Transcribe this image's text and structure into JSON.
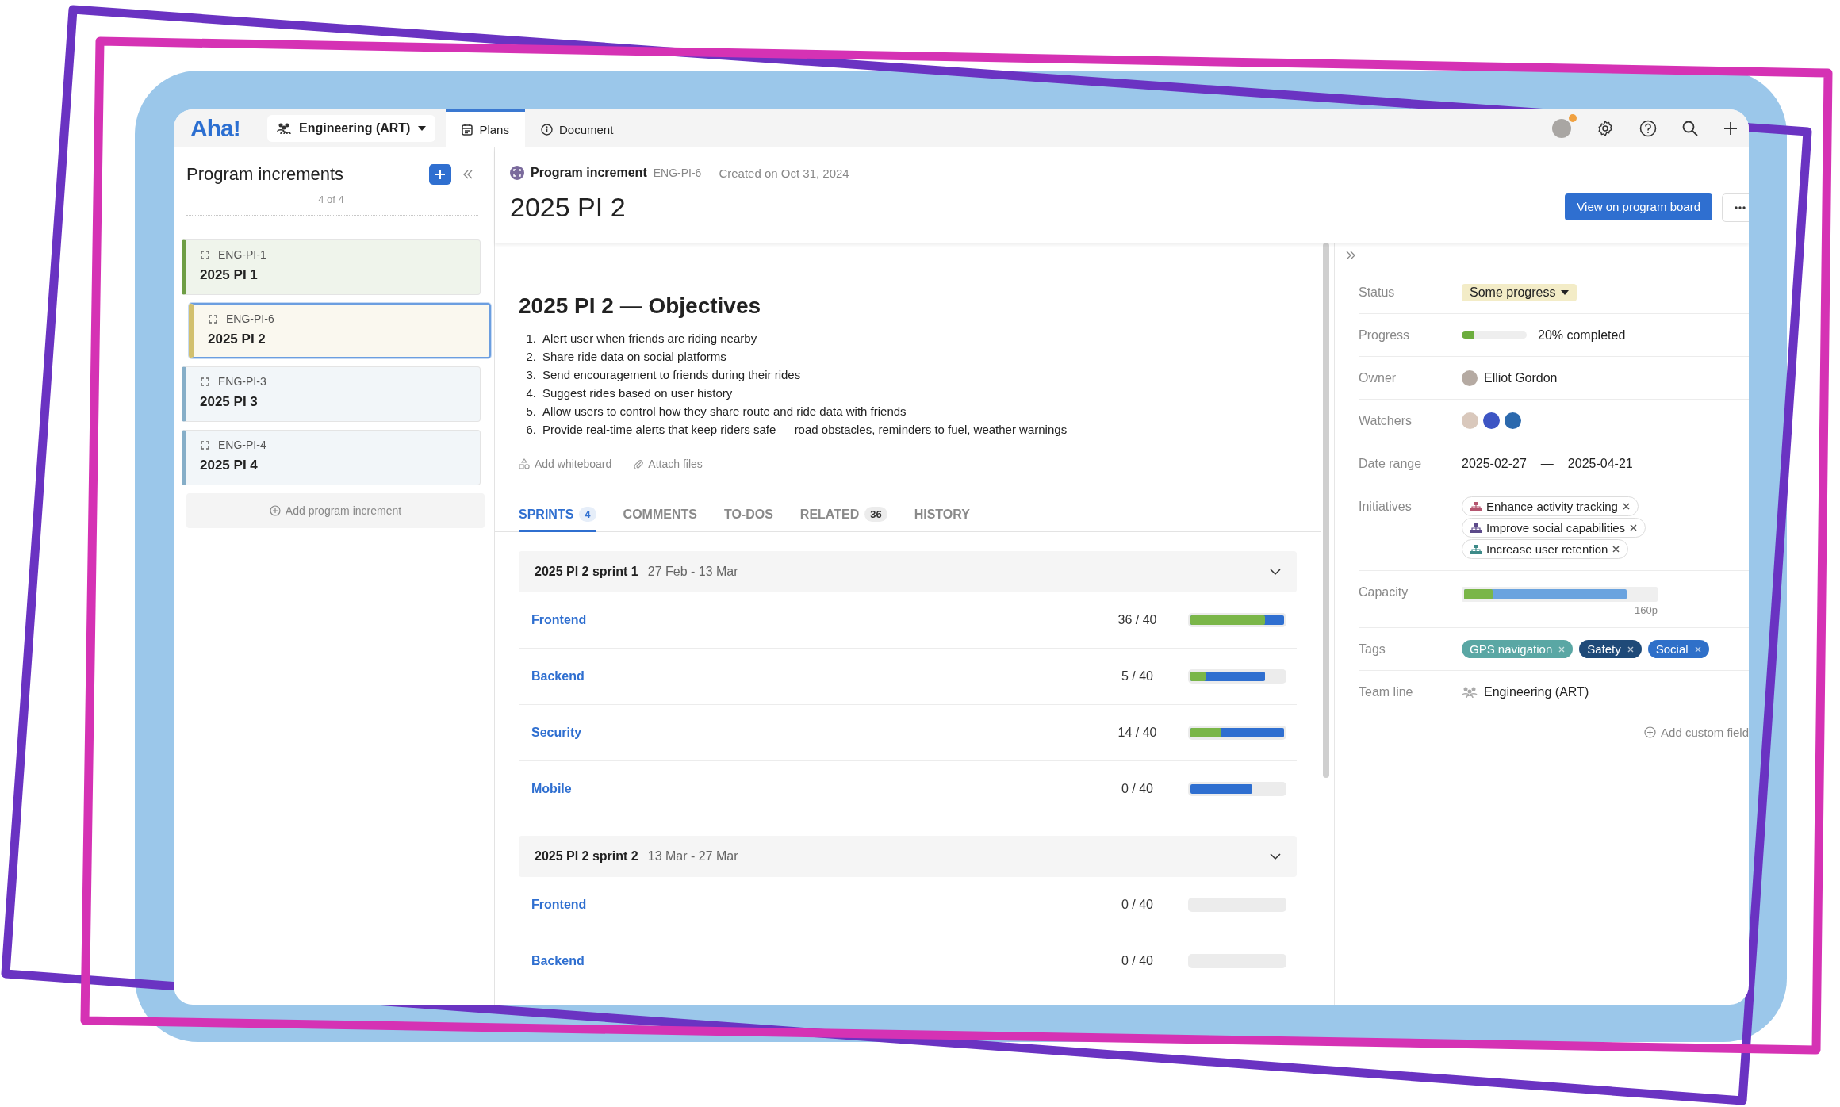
{
  "topbar": {
    "logo": "Aha!",
    "workspace": "Engineering (ART)",
    "tabs": [
      {
        "label": "Plans",
        "selected": true
      },
      {
        "label": "Document",
        "selected": false
      }
    ],
    "notification": true
  },
  "sidebar": {
    "title": "Program increments",
    "count": "4 of 4",
    "items": [
      {
        "ref": "ENG-PI-1",
        "name": "2025 PI 1",
        "color": "#6f9e45",
        "selected": false
      },
      {
        "ref": "ENG-PI-6",
        "name": "2025 PI 2",
        "color": "#d2c06e",
        "selected": true
      },
      {
        "ref": "ENG-PI-3",
        "name": "2025 PI 3",
        "color": "#86aec8",
        "selected": false
      },
      {
        "ref": "ENG-PI-4",
        "name": "2025 PI 4",
        "color": "#86aec8",
        "selected": false
      }
    ],
    "add_label": "Add program increment"
  },
  "record": {
    "type_label": "Program increment",
    "ref": "ENG-PI-6",
    "created": "Created on Oct 31, 2024",
    "title": "2025 PI 2",
    "primary_action": "View on program board"
  },
  "objectives": {
    "heading": "2025 PI 2 — Objectives",
    "items": [
      {
        "number": "1.",
        "text": "Alert user when friends are riding nearby"
      },
      {
        "number": "2.",
        "text": "Share ride data on social platforms"
      },
      {
        "number": "3.",
        "text": "Send encouragement to friends during their rides"
      },
      {
        "number": "4.",
        "text": "Suggest rides based on user history"
      },
      {
        "number": "5.",
        "text": "Allow users to control how they share route and ride data with friends"
      },
      {
        "number": "6.",
        "text": "Provide real-time alerts that keep riders safe — road obstacles, reminders to fuel, weather warnings"
      }
    ],
    "actions": [
      {
        "kind": "whiteboard",
        "label": "Add whiteboard"
      },
      {
        "kind": "attach",
        "label": "Attach files"
      }
    ]
  },
  "detail_tabs": [
    {
      "label": "SPRINTS",
      "count": "4",
      "selected": true
    },
    {
      "label": "COMMENTS",
      "selected": false
    },
    {
      "label": "TO-DOS",
      "selected": false
    },
    {
      "label": "RELATED",
      "count": "36",
      "selected": false
    },
    {
      "label": "HISTORY",
      "selected": false
    }
  ],
  "sprints": [
    {
      "name": "2025 PI 2 sprint 1",
      "dates": "27 Feb - 13 Mar",
      "expanded": true,
      "teams": [
        {
          "name": "Frontend",
          "reading": "36 / 40",
          "segments": [
            {
              "kind": "planned",
              "level": 1
            },
            {
              "kind": "done",
              "level": 0.8
            }
          ]
        },
        {
          "name": "Backend",
          "reading": "5 / 40",
          "segments": [
            {
              "kind": "planned",
              "level": 0.8
            },
            {
              "kind": "done",
              "level": 0.16
            }
          ]
        },
        {
          "name": "Security",
          "reading": "14 / 40",
          "segments": [
            {
              "kind": "planned",
              "level": 1
            },
            {
              "kind": "done",
              "level": 0.33
            }
          ]
        },
        {
          "name": "Mobile",
          "reading": "0 / 40",
          "segments": [
            {
              "kind": "planned",
              "level": 0.66
            }
          ]
        }
      ]
    },
    {
      "name": "2025 PI 2 sprint 2",
      "dates": "13 Mar - 27 Mar",
      "expanded": true,
      "teams": [
        {
          "name": "Frontend",
          "reading": "0 / 40"
        },
        {
          "name": "Backend",
          "reading": "0 / 40"
        }
      ]
    }
  ],
  "details": {
    "fields": [
      {
        "kind": "status",
        "label": "Status",
        "value": "Some progress"
      },
      {
        "kind": "progress",
        "label": "Progress",
        "level": 0.2,
        "value": "20% completed"
      },
      {
        "kind": "owner",
        "label": "Owner",
        "value": "Elliot Gordon"
      },
      {
        "kind": "watchers",
        "label": "Watchers",
        "avatars": [
          {
            "color": "#d9c8bc"
          },
          {
            "color": "#3d55c4"
          },
          {
            "color": "#2c69ad"
          }
        ]
      },
      {
        "kind": "dates",
        "label": "Date range",
        "start": "2025-02-27",
        "separator": "—",
        "end": "2025-04-21"
      },
      {
        "kind": "initiatives",
        "label": "Initiatives",
        "items": [
          {
            "name": "Enhance activity tracking",
            "color": "#b4556f"
          },
          {
            "name": "Improve social capabilities",
            "color": "#5c4a8a"
          },
          {
            "name": "Increase user retention",
            "color": "#3d8a88"
          }
        ]
      },
      {
        "kind": "capacity",
        "label": "Capacity",
        "segments": [
          {
            "kind": "allocated",
            "level": 0.85
          },
          {
            "kind": "done",
            "level": 0.15
          }
        ],
        "reading": "160p"
      },
      {
        "kind": "tags",
        "label": "Tags",
        "items": [
          {
            "name": "GPS navigation",
            "color": "#5aa7a4"
          },
          {
            "name": "Safety",
            "color": "#1f4a78"
          },
          {
            "name": "Social",
            "color": "#2f70c9"
          }
        ]
      },
      {
        "kind": "team",
        "label": "Team line",
        "value": "Engineering (ART)"
      }
    ],
    "add_field": "Add custom field"
  }
}
